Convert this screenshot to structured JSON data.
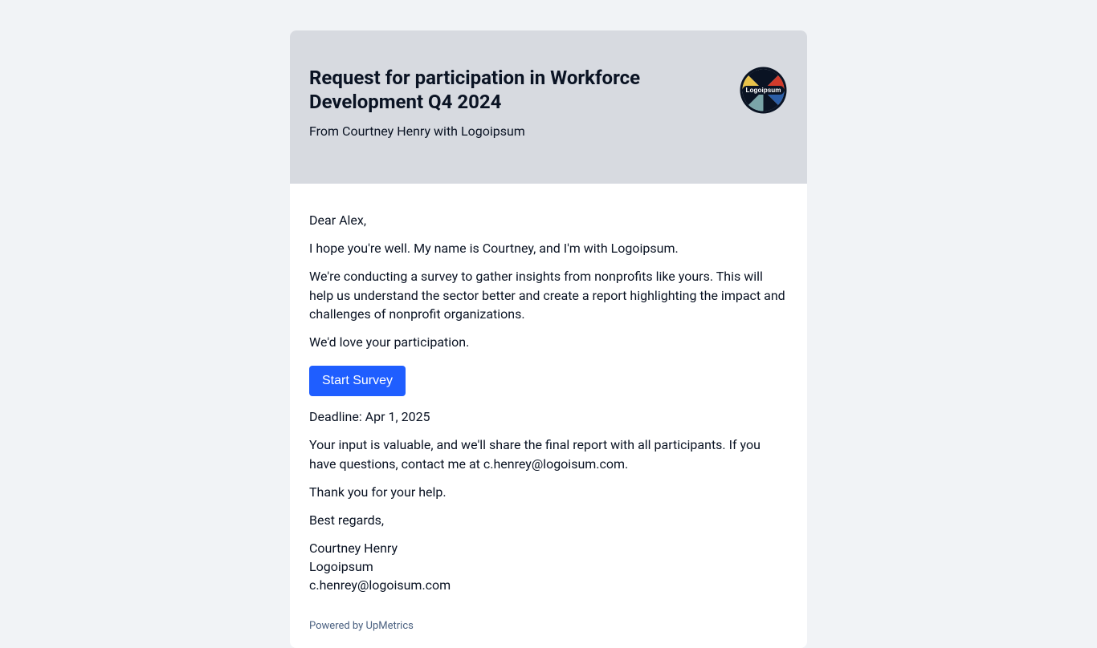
{
  "header": {
    "title": "Request for participation in Workforce Development Q4 2024",
    "from": "From Courtney Henry with Logoipsum",
    "logo_text": "Logoipsum"
  },
  "body": {
    "greeting": "Dear Alex,",
    "intro": "I hope you're well. My name is Courtney, and I'm with Logoipsum.",
    "desc": "We're conducting a survey to gather insights from nonprofits like yours. This will help us understand the sector better and create a report highlighting the impact and challenges of nonprofit organizations.",
    "ask": "We'd love your participation.",
    "button": "Start Survey",
    "deadline": "Deadline: Apr 1, 2025",
    "followup": "Your input is valuable, and we'll share the final report with all participants. If you have questions, contact me at c.henrey@logoisum.com.",
    "thanks": "Thank you for your help.",
    "regards": "Best regards,",
    "sig_name": "Courtney Henry",
    "sig_org": "Logoipsum",
    "sig_email": "c.henrey@logoisum.com",
    "powered": "Powered by UpMetrics"
  },
  "colors": {
    "primary": "#1f5eff"
  }
}
